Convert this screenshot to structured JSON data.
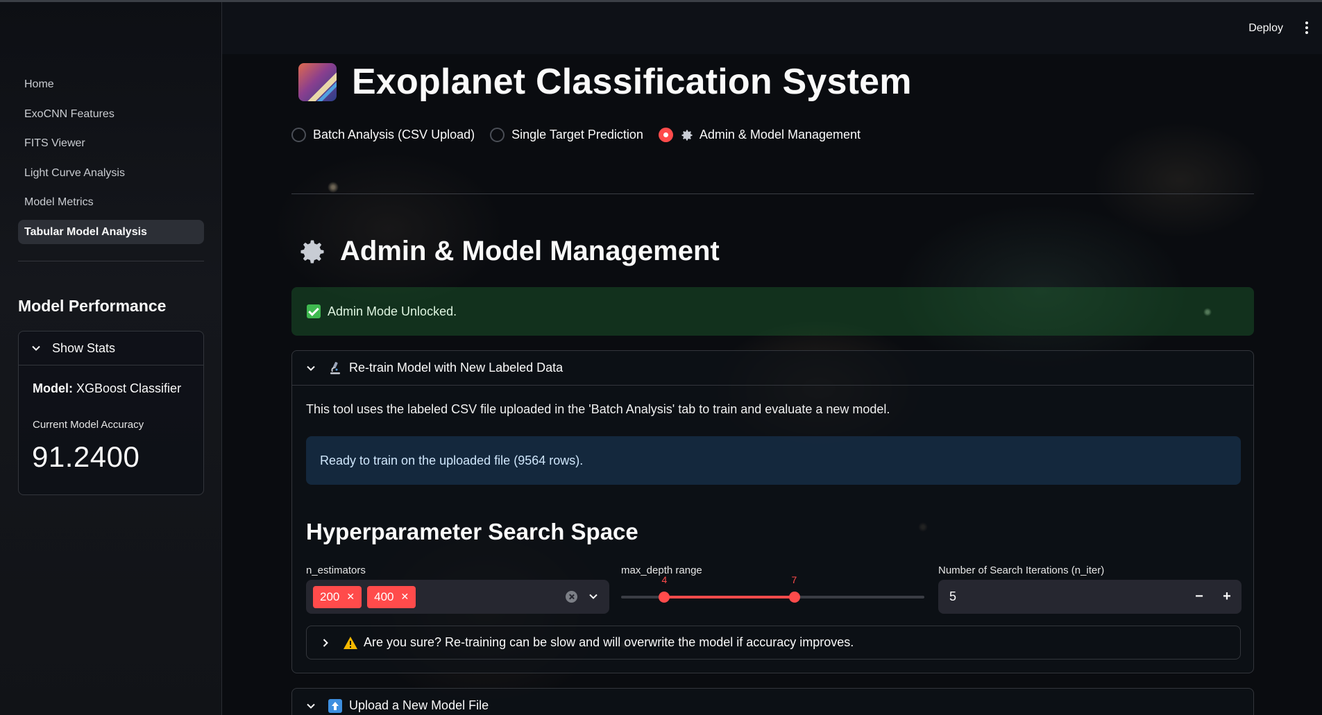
{
  "sidebar": {
    "nav": [
      "Home",
      "ExoCNN Features",
      "FITS Viewer",
      "Light Curve Analysis",
      "Model Metrics",
      "Tabular Model Analysis"
    ],
    "active_index": 5,
    "performance_heading": "Model Performance",
    "stats_toggle": "Show Stats",
    "model_label": "Model:",
    "model_name": "XGBoost Classifier",
    "accuracy_label": "Current Model Accuracy",
    "accuracy_value": "91.2400"
  },
  "header": {
    "deploy": "Deploy",
    "menu_icon": "kebab-menu-icon"
  },
  "main": {
    "title": "Exoplanet Classification System",
    "title_icon": "shooting-star-icon",
    "modes": [
      {
        "label": "Batch Analysis (CSV Upload)",
        "selected": false
      },
      {
        "label": "Single Target Prediction",
        "selected": false
      },
      {
        "label": "Admin & Model Management",
        "selected": true,
        "icon": "gear-icon"
      }
    ],
    "section_title": "Admin & Model Management",
    "success_message": "Admin Mode Unlocked.",
    "retrain": {
      "title": "Re-train Model with New Labeled Data",
      "icon": "microscope-icon",
      "description": "This tool uses the labeled CSV file uploaded in the 'Batch Analysis' tab to train and evaluate a new model.",
      "info": "Ready to train on the uploaded file (9564 rows).",
      "subheading": "Hyperparameter Search Space",
      "n_estimators_label": "n_estimators",
      "n_estimators_values": [
        "200",
        "400"
      ],
      "max_depth_label": "max_depth range",
      "max_depth_min": "4",
      "max_depth_max": "7",
      "max_depth_low_fraction": 0.143,
      "max_depth_high_fraction": 0.571,
      "n_iter_label": "Number of Search Iterations (n_iter)",
      "n_iter_value": "5",
      "confirm_text": "Are you sure? Re-training can be slow and will overwrite the model if accuracy improves."
    },
    "upload": {
      "title": "Upload a New Model File",
      "icon": "upload-arrow-icon"
    }
  },
  "colors": {
    "accent": "#ff4b4b",
    "success_bg": "#1f5b2e",
    "info_bg": "#1c3c5f",
    "app_bg": "#0e1117"
  }
}
